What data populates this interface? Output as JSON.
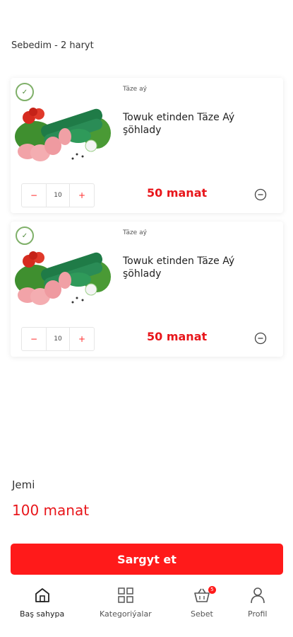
{
  "cart": {
    "header": "Sebedim - 2 haryt",
    "items": [
      {
        "brand": "Täze aý",
        "title": "Towuk etinden Täze Aý şöhlady",
        "quantity": "10",
        "minus": "−",
        "plus": "+",
        "price": "50 manat"
      },
      {
        "brand": "Täze aý",
        "title": "Towuk etinden Täze Aý şöhlady",
        "quantity": "10",
        "minus": "−",
        "plus": "+",
        "price": "50 manat"
      }
    ]
  },
  "summary": {
    "total_label": "Jemi",
    "total_value": "100 manat"
  },
  "actions": {
    "order_label": "Sargyt et"
  },
  "bottom_nav": {
    "items": [
      {
        "label": "Baş sahypa",
        "icon": "home-icon"
      },
      {
        "label": "Kategoriýalar",
        "icon": "grid-icon"
      },
      {
        "label": "Sebet",
        "icon": "basket-icon",
        "badge": "5"
      },
      {
        "label": "Profil",
        "icon": "user-icon"
      }
    ]
  },
  "colors": {
    "accent": "#ff1a1a",
    "price": "#e8161b"
  }
}
